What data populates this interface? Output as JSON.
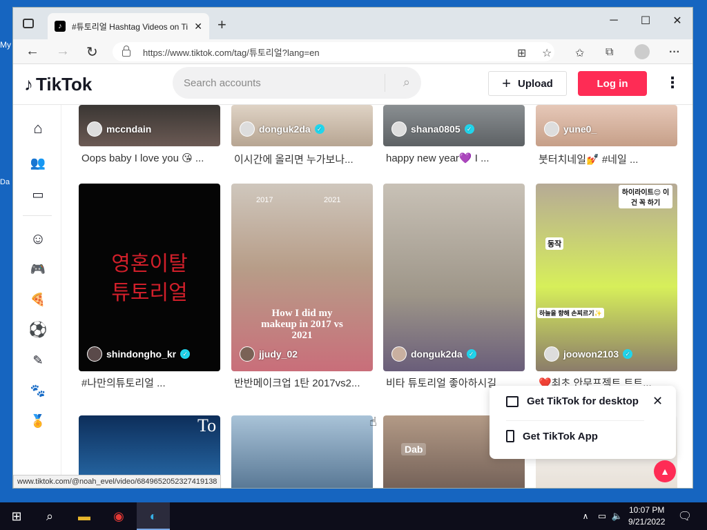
{
  "desktop": {
    "labels": [
      "My",
      "Da"
    ]
  },
  "browser": {
    "tab_title": "#튜토리얼 Hashtag Videos on Ti",
    "tab_favicon": "tiktok-icon",
    "url": "https://www.tiktok.com/tag/튜토리얼?lang=en",
    "status_url": "www.tiktok.com/@noah_evel/video/6849652052327419138"
  },
  "tiktok": {
    "logo_text": "TikTok",
    "search_placeholder": "Search accounts",
    "upload_label": "Upload",
    "login_label": "Log in"
  },
  "sidebar": [
    {
      "icon": "home-icon"
    },
    {
      "icon": "following-icon"
    },
    {
      "icon": "live-icon"
    },
    {
      "icon": "comedy-icon"
    },
    {
      "icon": "gaming-icon"
    },
    {
      "icon": "food-icon"
    },
    {
      "icon": "sports-icon"
    },
    {
      "icon": "beauty-icon"
    },
    {
      "icon": "animals-icon"
    },
    {
      "icon": "medal-icon"
    }
  ],
  "videos": [
    {
      "user": "mccndain",
      "verified": false,
      "caption": "Oops baby I love you 😘 ..."
    },
    {
      "user": "donguk2da",
      "verified": true,
      "caption": "이시간에 올리면 누가보나..."
    },
    {
      "user": "shana0805",
      "verified": true,
      "caption": "happy new year💜 I ..."
    },
    {
      "user": "yune0_",
      "verified": false,
      "caption": "붓터치네일💅 #네일 ..."
    },
    {
      "user": "shindongho_kr",
      "verified": true,
      "caption": "#나만의튜토리얼 ...",
      "overlay": "영혼이탈\n튜토리얼"
    },
    {
      "user": "jjudy_02",
      "verified": false,
      "caption": "반반메이크업 1탄 2017vs2...",
      "overlay": "How I did my makeup in 2017 vs 2021",
      "years": [
        "2017",
        "2021"
      ]
    },
    {
      "user": "donguk2da",
      "verified": true,
      "caption": "비타 튜토리얼 좋아하시길"
    },
    {
      "user": "joowon2103",
      "verified": true,
      "caption": "❤️최초 안무프젝트 트트...",
      "tags": [
        "하이라이트😌 이건 꼭 하기",
        "동작",
        "하늘을 향해 손찌르기✨"
      ]
    }
  ],
  "row3": [
    {
      "overlay": "To"
    },
    {
      "overlay": ""
    },
    {
      "overlay": "Dab"
    },
    {
      "overlay": ""
    }
  ],
  "popup": {
    "desktop_label": "Get TikTok for desktop",
    "app_label": "Get TikTok App"
  },
  "taskbar": {
    "time": "10:07 PM",
    "date": "9/21/2022"
  }
}
